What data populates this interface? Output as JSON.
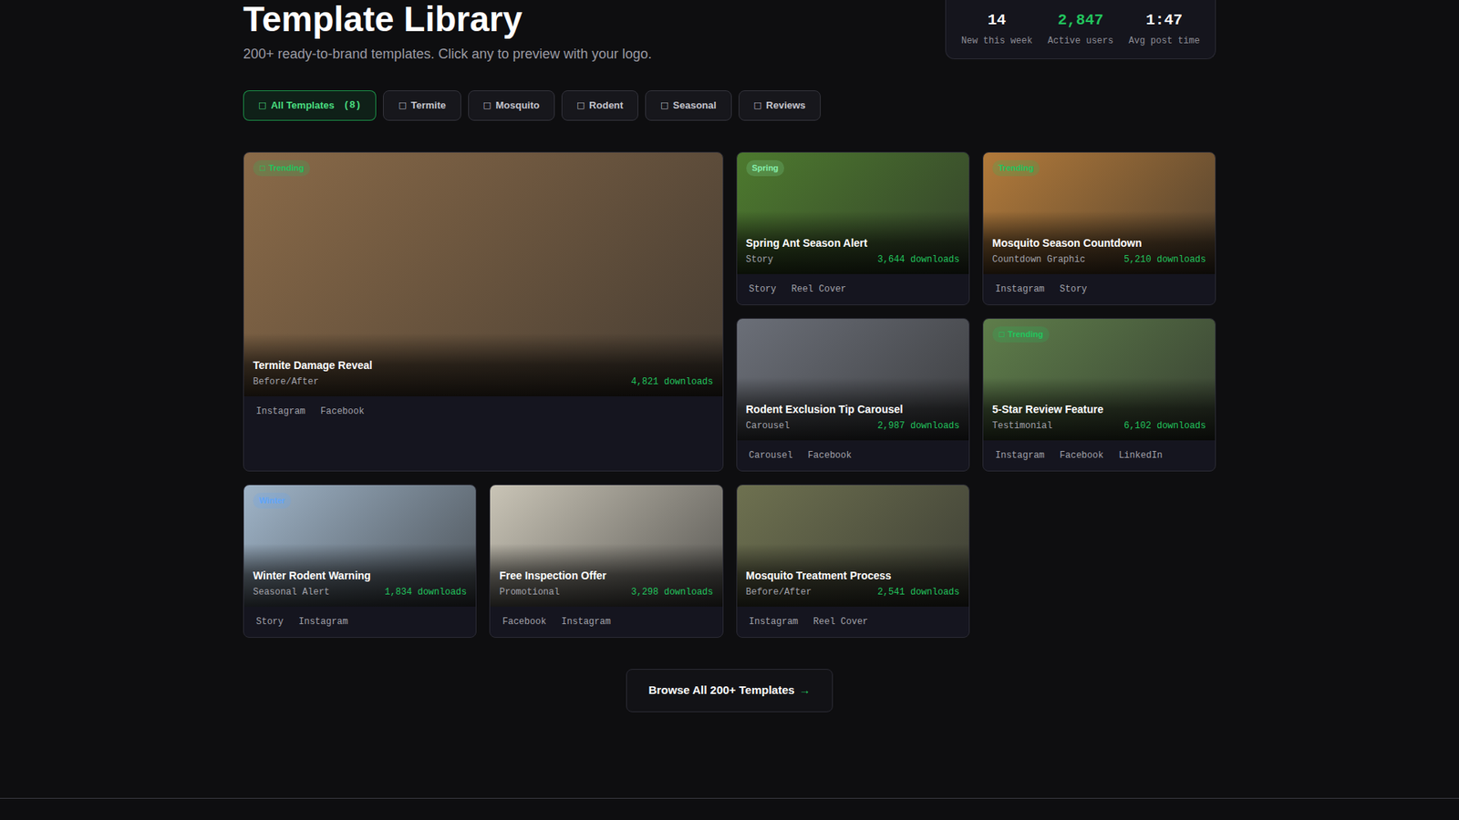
{
  "header": {
    "title": "Template Library",
    "subtitle": "200+ ready-to-brand templates. Click any to preview with your logo."
  },
  "stats": [
    {
      "value": "14",
      "label": "New this week",
      "color": "#ffffff"
    },
    {
      "value": "2,847",
      "label": "Active users",
      "color": "#22c55e"
    },
    {
      "value": "1:47",
      "label": "Avg post time",
      "color": "#ffffff"
    }
  ],
  "filters": [
    {
      "icon": "□",
      "label": "All Templates",
      "count": "(8)",
      "selected": true
    },
    {
      "icon": "□",
      "label": "Termite",
      "selected": false
    },
    {
      "icon": "□",
      "label": "Mosquito",
      "selected": false
    },
    {
      "icon": "□",
      "label": "Rodent",
      "selected": false
    },
    {
      "icon": "□",
      "label": "Seasonal",
      "selected": false
    },
    {
      "icon": "□",
      "label": "Reviews",
      "selected": false
    }
  ],
  "templates": [
    {
      "kind": "featured",
      "title": "Termite Damage Reveal",
      "type": "Before/After",
      "downloads": "4,821 downloads",
      "badge": {
        "icon": "□",
        "text": "Trending",
        "color": "#22c55e"
      },
      "color": "#8a6a48",
      "tags": [
        "Instagram",
        "Facebook"
      ]
    },
    {
      "kind": "standard",
      "title": "Spring Ant Season Alert",
      "type": "Story",
      "downloads": "3,644 downloads",
      "badge": {
        "text": "Spring",
        "color": "#86efac"
      },
      "color": "#4d7a2e",
      "tags": [
        "Story",
        "Reel Cover"
      ]
    },
    {
      "kind": "standard",
      "title": "Mosquito Season Countdown",
      "type": "Countdown Graphic",
      "downloads": "5,210 downloads",
      "badge": {
        "text": "Trending",
        "color": "#22c55e"
      },
      "color": "#b27a3a",
      "tags": [
        "Instagram",
        "Story"
      ]
    },
    {
      "kind": "standard",
      "title": "Rodent Exclusion Tip Carousel",
      "type": "Carousel",
      "downloads": "2,987 downloads",
      "badge": null,
      "color": "#6b6f78",
      "tags": [
        "Carousel",
        "Facebook"
      ]
    },
    {
      "kind": "standard",
      "title": "5-Star Review Feature",
      "type": "Testimonial",
      "downloads": "6,102 downloads",
      "badge": {
        "icon": "□",
        "text": "Trending",
        "color": "#22c55e"
      },
      "color": "#5e7d4a",
      "tags": [
        "Instagram",
        "Facebook",
        "LinkedIn"
      ]
    },
    {
      "kind": "standard",
      "title": "Winter Rodent Warning",
      "type": "Seasonal Alert",
      "downloads": "1,834 downloads",
      "badge": {
        "text": "Winter",
        "color": "#60a5fa"
      },
      "color": "#9fb4c8",
      "tags": [
        "Story",
        "Instagram"
      ]
    },
    {
      "kind": "standard",
      "title": "Free Inspection Offer",
      "type": "Promotional",
      "downloads": "3,298 downloads",
      "badge": null,
      "color": "#c9c4b6",
      "tags": [
        "Facebook",
        "Instagram"
      ]
    },
    {
      "kind": "standard",
      "title": "Mosquito Treatment Process",
      "type": "Before/After",
      "downloads": "2,541 downloads",
      "badge": null,
      "color": "#6e7150",
      "tags": [
        "Instagram",
        "Reel Cover"
      ]
    }
  ],
  "browse": {
    "label": "Browse All 200+ Templates",
    "arrow": "→"
  }
}
